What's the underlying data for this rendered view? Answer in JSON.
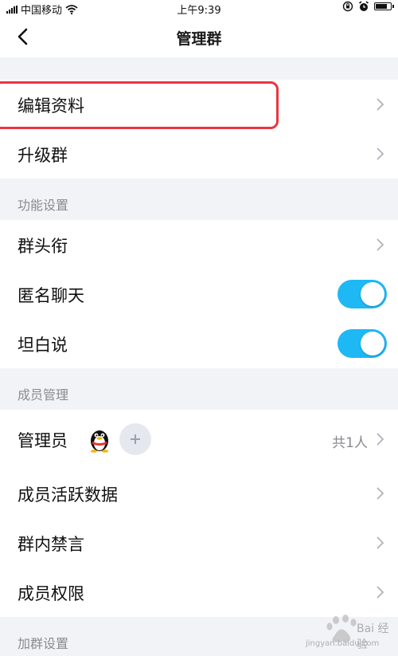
{
  "status_bar": {
    "carrier": "中国移动",
    "time": "上午9:39",
    "battery_level": 0.85
  },
  "nav": {
    "title": "管理群"
  },
  "groups": {
    "top": {
      "edit_profile": "编辑资料",
      "upgrade_group": "升级群"
    },
    "features": {
      "header": "功能设置",
      "group_titles": "群头衔",
      "anonymous_chat": "匿名聊天",
      "anonymous_chat_on": true,
      "honest_talk": "坦白说",
      "honest_talk_on": true
    },
    "members": {
      "header": "成员管理",
      "admins": "管理员",
      "admins_count": "共1人",
      "member_activity": "成员活跃数据",
      "group_mute": "群内禁言",
      "member_permissions": "成员权限"
    },
    "join": {
      "header": "加群设置"
    }
  },
  "colors": {
    "toggle_on": "#1eb8f5",
    "highlight_frame": "#e8363f",
    "background": "#f2f3f7"
  },
  "watermark": {
    "brand": "Bai 经验",
    "url": "jingyan.baidu.com"
  }
}
